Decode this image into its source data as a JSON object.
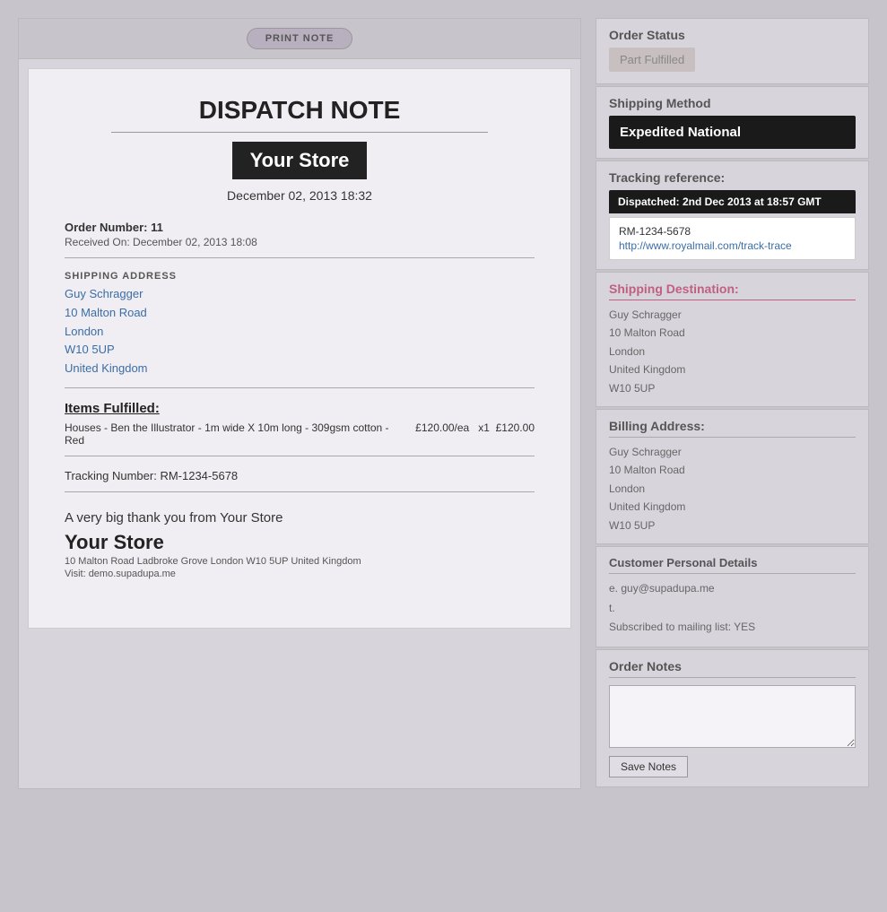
{
  "print_bar": {
    "button_label": "PRINT NOTE"
  },
  "dispatch_doc": {
    "title": "DISPATCH NOTE",
    "store_name": "Your Store",
    "date": "December 02, 2013 18:32",
    "order_number_label": "Order Number: 11",
    "received_on": "Received On: December 02, 2013 18:08",
    "shipping_address_label": "SHIPPING ADDRESS",
    "shipping_address": {
      "name": "Guy Schragger",
      "line1": "10 Malton Road",
      "city": "London",
      "postcode": "W10 5UP",
      "country": "United Kingdom"
    },
    "items_heading": "Items Fulfilled:",
    "items": [
      {
        "description": "Houses - Ben the Illustrator - 1m wide X 10m long - 309gsm cotton - Red",
        "price": "£120.00/ea",
        "quantity": "x1",
        "total": "£120.00"
      }
    ],
    "tracking_number": "Tracking Number: RM-1234-5678",
    "thank_you": "A very big thank you from Your Store",
    "footer_store_name": "Your Store",
    "footer_address": "10 Malton Road Ladbroke Grove London W10 5UP United Kingdom",
    "footer_website": "Visit: demo.supadupa.me"
  },
  "right_panel": {
    "order_status": {
      "title": "Order Status",
      "badge": "Part Fulfilled"
    },
    "shipping_method": {
      "title": "Shipping Method",
      "value": "Expedited National"
    },
    "tracking_reference": {
      "title": "Tracking reference:",
      "dispatch_label": "Dispatched: 2nd Dec 2013 at 18:57 GMT",
      "tracking_id": "RM-1234-5678",
      "tracking_url": "http://www.royalmail.com/track-trace"
    },
    "shipping_destination": {
      "title": "Shipping Destination:",
      "address": {
        "name": "Guy Schragger",
        "line1": "10 Malton Road",
        "city": "London",
        "country": "United Kingdom",
        "postcode": "W10 5UP"
      }
    },
    "billing_address": {
      "title": "Billing Address:",
      "address": {
        "name": "Guy Schragger",
        "line1": "10 Malton Road",
        "city": "London",
        "country": "United Kingdom",
        "postcode": "W10 5UP"
      }
    },
    "customer_personal_details": {
      "title": "Customer Personal Details",
      "email_label": "e.",
      "email_value": "guy@supadupa.me",
      "phone_label": "t.",
      "phone_value": "",
      "mailing_list": "Subscribed to mailing list: YES"
    },
    "order_notes": {
      "title": "Order Notes",
      "save_button": "Save Notes"
    }
  }
}
